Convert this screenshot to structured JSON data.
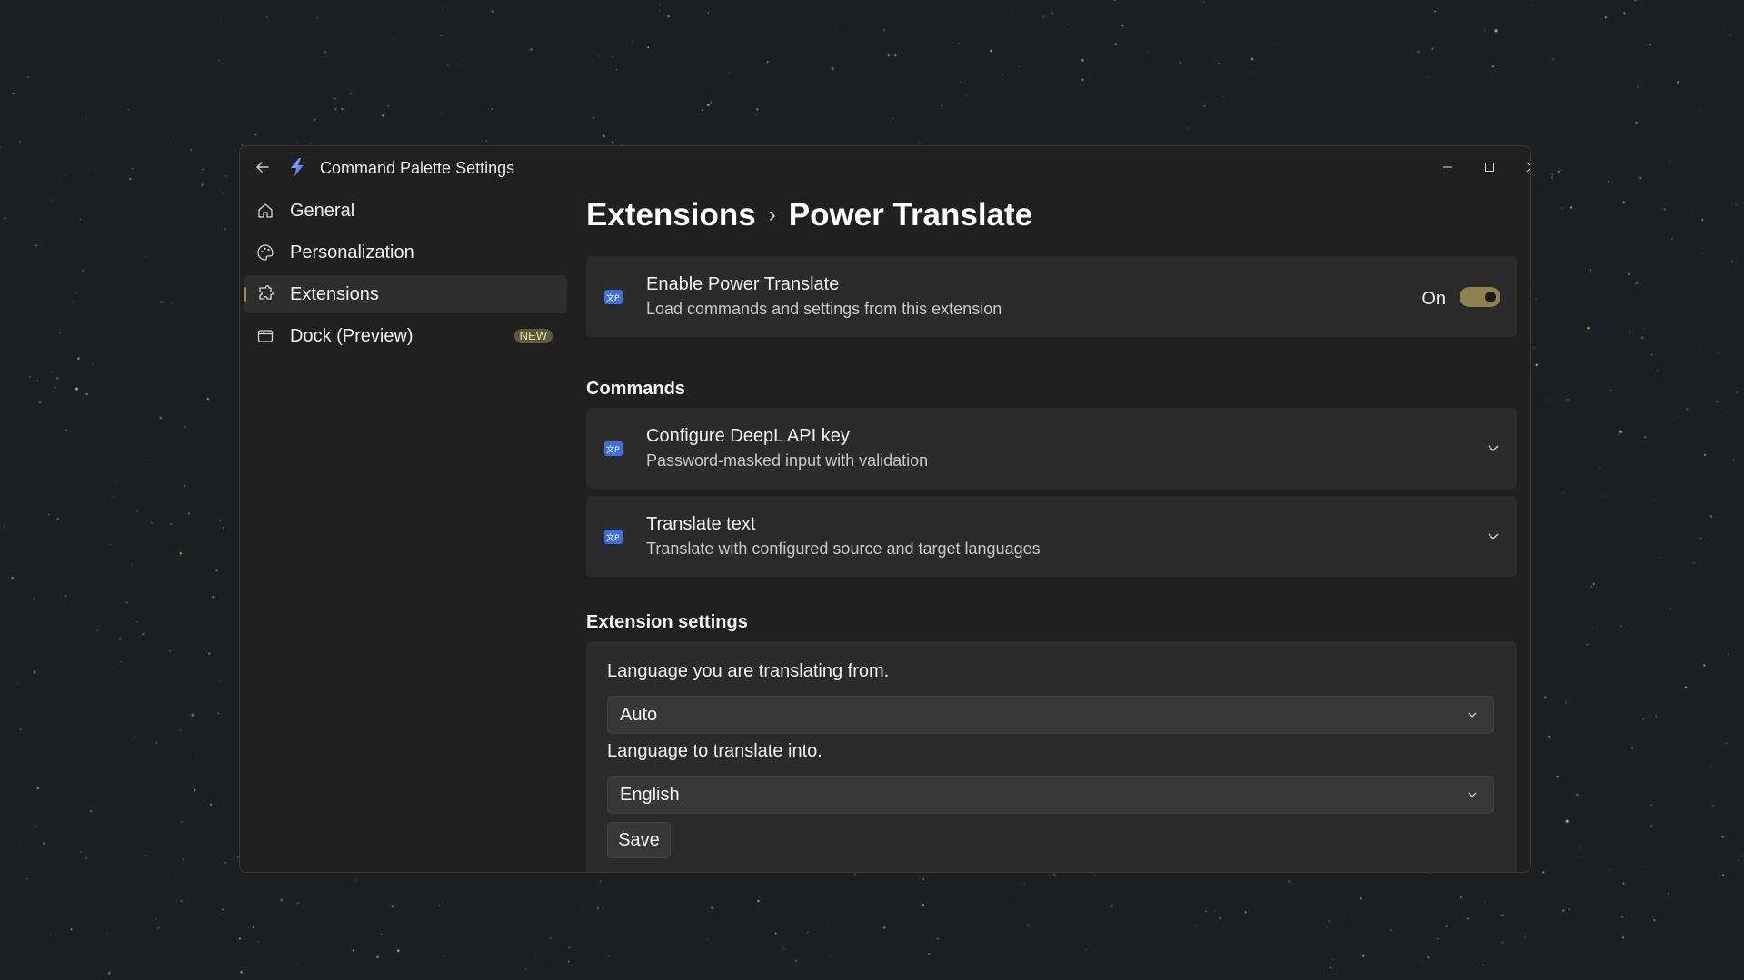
{
  "window": {
    "title": "Command Palette Settings",
    "accent": "#8f8250"
  },
  "sidebar": {
    "items": [
      {
        "label": "General",
        "icon": "home-icon"
      },
      {
        "label": "Personalization",
        "icon": "palette-icon"
      },
      {
        "label": "Extensions",
        "icon": "puzzle-icon",
        "active": true
      },
      {
        "label": "Dock (Preview)",
        "icon": "dock-icon",
        "badge": "NEW"
      }
    ]
  },
  "breadcrumb": {
    "parent": "Extensions",
    "separator": "›",
    "current": "Power Translate"
  },
  "enable_card": {
    "title": "Enable Power Translate",
    "subtitle": "Load commands and settings from this extension",
    "toggle_state": "On",
    "toggle_on": true
  },
  "commands": {
    "heading": "Commands",
    "items": [
      {
        "title": "Configure DeepL API key",
        "subtitle": "Password-masked input with validation"
      },
      {
        "title": "Translate text",
        "subtitle": "Translate with configured source and target languages"
      }
    ]
  },
  "settings": {
    "heading": "Extension settings",
    "from_label": "Language you are translating from.",
    "from_value": "Auto",
    "to_label": "Language to translate into.",
    "to_value": "English",
    "save_label": "Save"
  }
}
